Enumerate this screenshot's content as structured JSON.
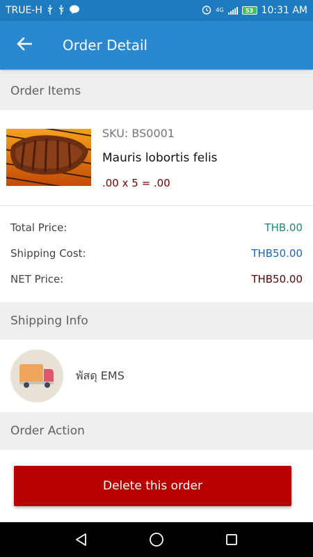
{
  "status_bar": {
    "carrier": "TRUE-H",
    "network": "4G",
    "battery": "53",
    "time": "10:31 AM"
  },
  "app_bar": {
    "title": "Order Detail"
  },
  "sections": {
    "order_items": "Order Items",
    "shipping_info": "Shipping Info",
    "order_action": "Order Action"
  },
  "item": {
    "sku": "SKU: BS0001",
    "name": "Mauris lobortis felis",
    "price_line": ".00 x 5 = .00"
  },
  "totals": {
    "total_price_label": "Total Price:",
    "total_price_value": "THB.00",
    "shipping_cost_label": "Shipping Cost:",
    "shipping_cost_value": "THB50.00",
    "net_price_label": "NET Price:",
    "net_price_value": "THB50.00"
  },
  "shipping": {
    "method": "พัสดุ EMS"
  },
  "action": {
    "delete_label": "Delete this order"
  },
  "colors": {
    "status_bar": "#1f7bbf",
    "app_bar": "#2a88d0",
    "total_price": "#1a8a7a",
    "shipping_cost": "#1565c0",
    "net_price": "#5d0000",
    "delete_button": "#b70000"
  },
  "icons": {
    "back": "arrow-left-icon",
    "truck": "truck-icon",
    "nav_back": "triangle-back-icon",
    "nav_home": "circle-home-icon",
    "nav_recents": "square-recents-icon"
  }
}
